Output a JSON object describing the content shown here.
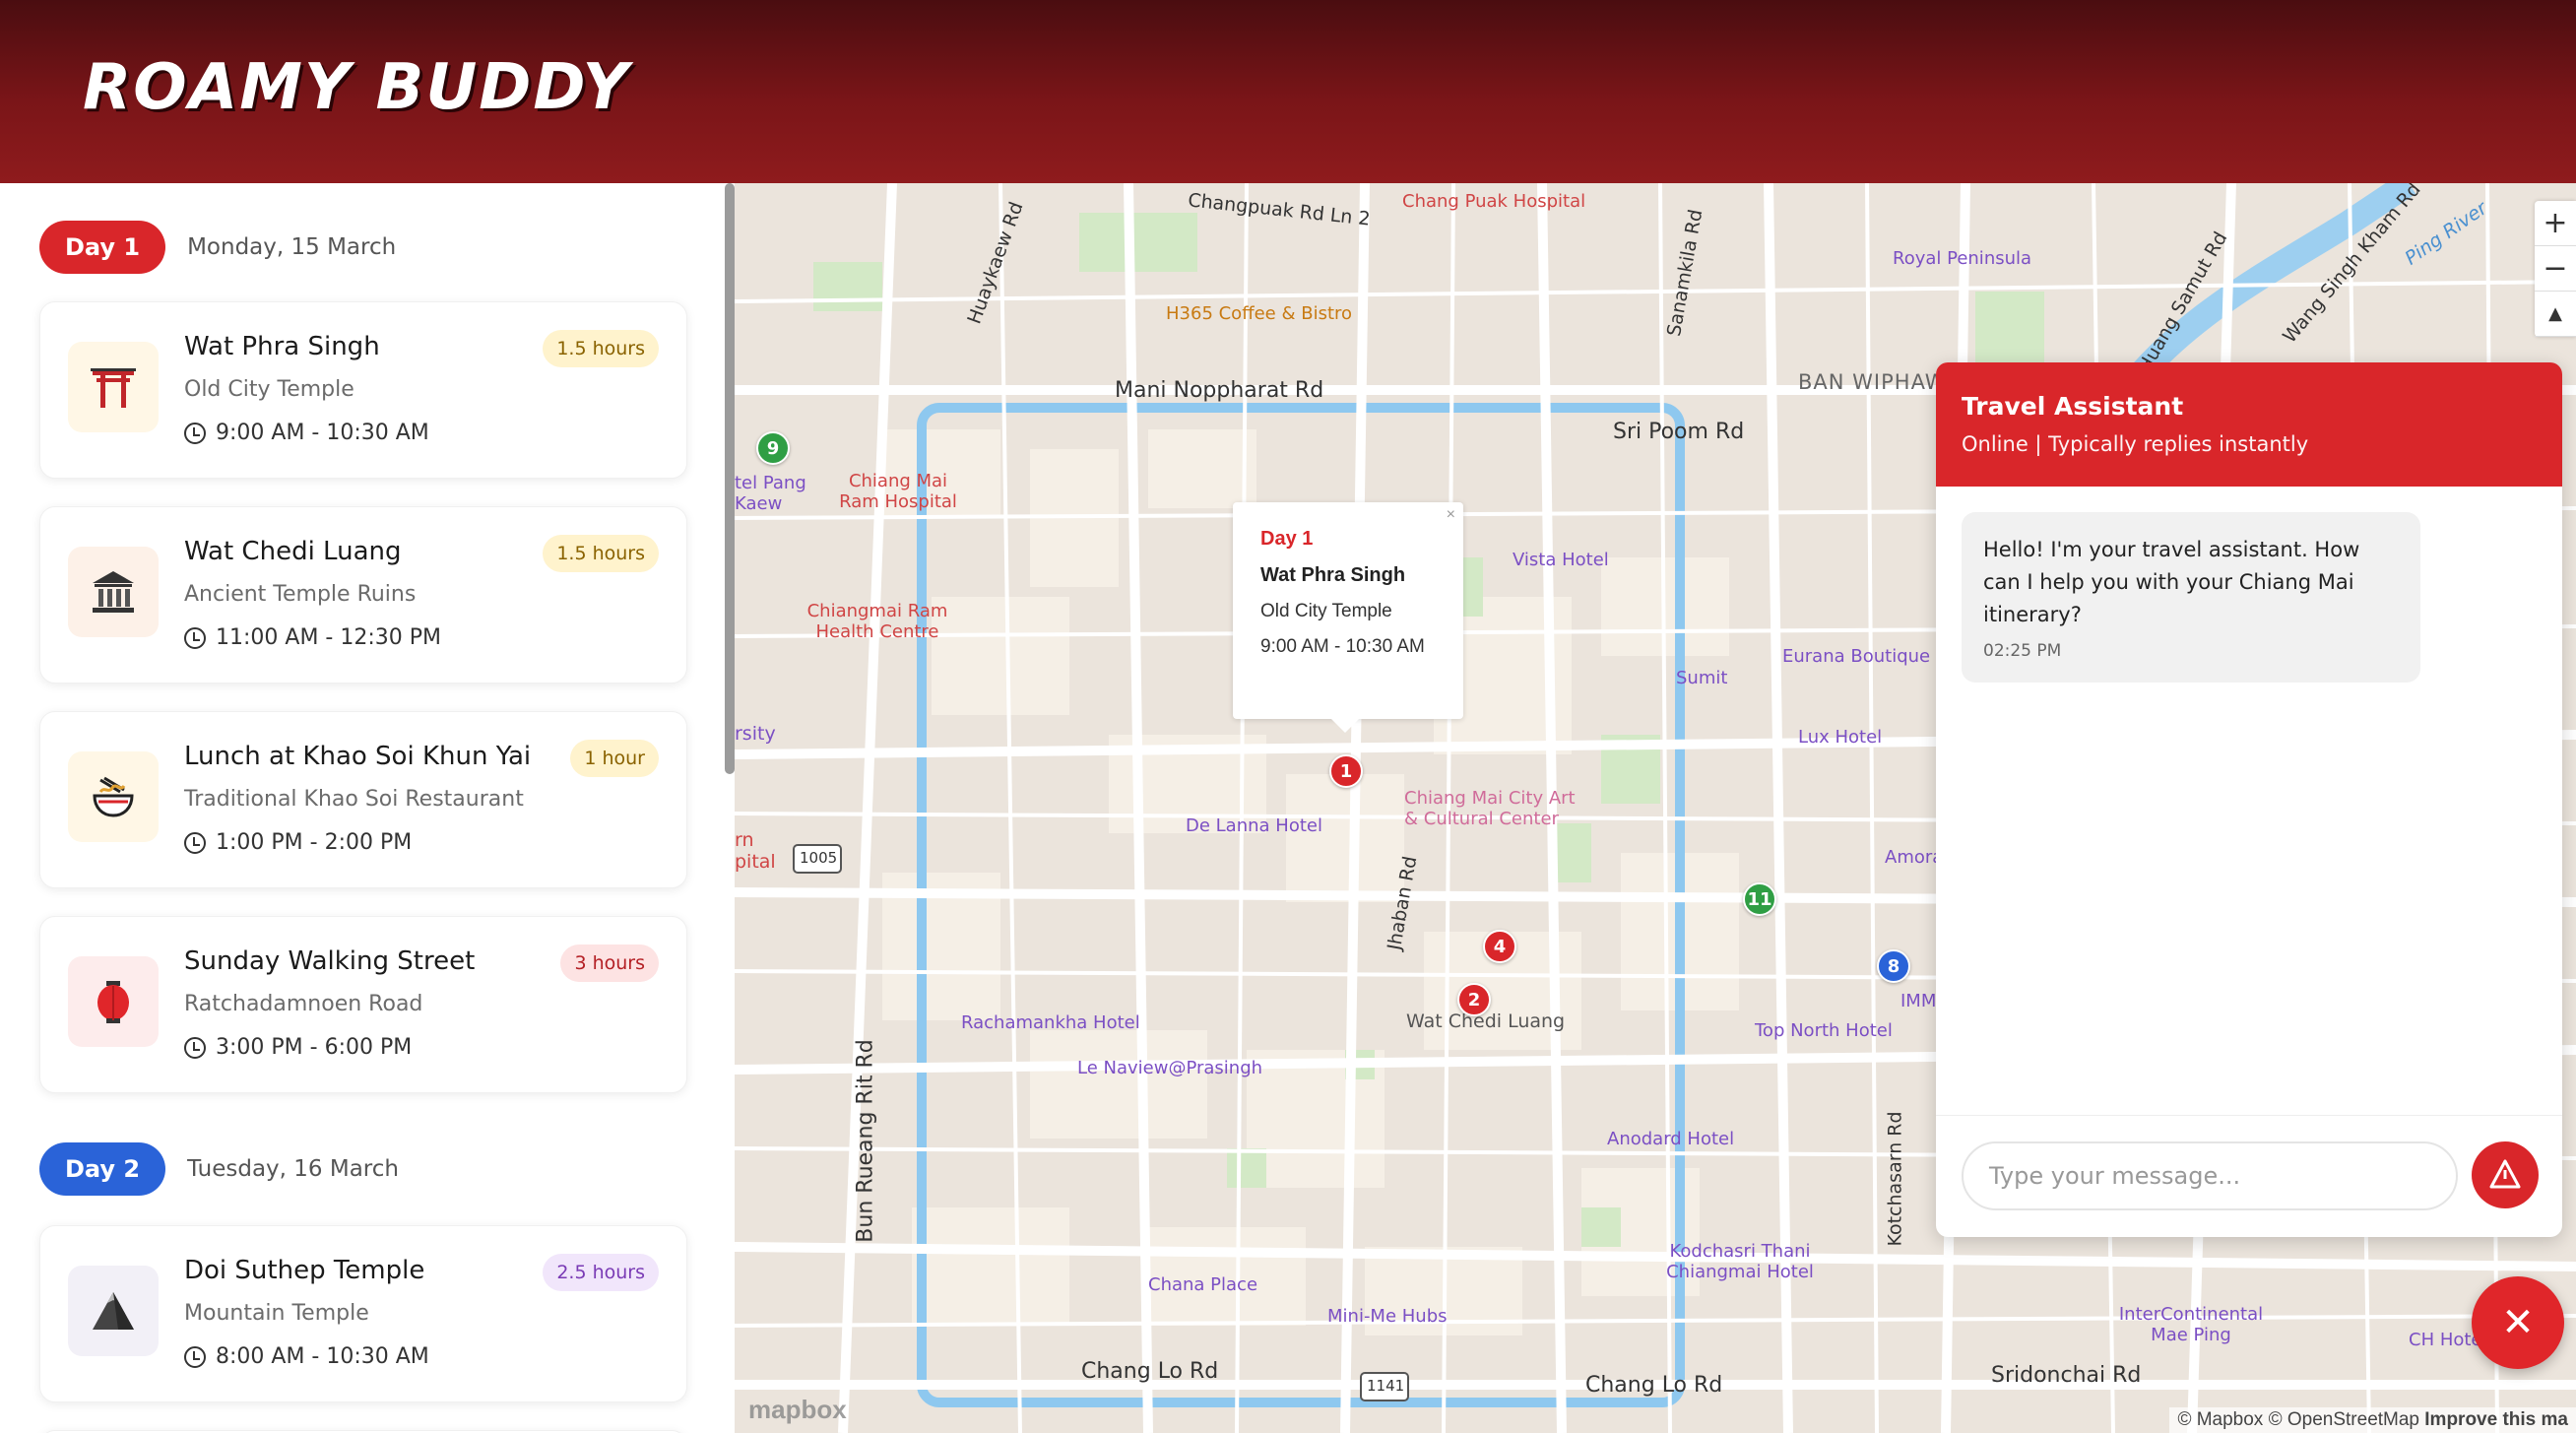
{
  "app": {
    "logo": "ROAMY BUDDY"
  },
  "colors": {
    "header": "#7a1518",
    "accent_red": "#d9262a",
    "day2_blue": "#2a63d8"
  },
  "days": [
    {
      "label": "Day 1",
      "date": "Monday, 15 March"
    },
    {
      "label": "Day 2",
      "date": "Tuesday, 16 March"
    }
  ],
  "activities": [
    {
      "title": "Wat Phra Singh",
      "subtitle": "Old City Temple",
      "time": "9:00 AM - 10:30 AM",
      "duration": "1.5 hours",
      "icon": "torii-gate-icon"
    },
    {
      "title": "Wat Chedi Luang",
      "subtitle": "Ancient Temple Ruins",
      "time": "11:00 AM - 12:30 PM",
      "duration": "1.5 hours",
      "icon": "classical-building-icon"
    },
    {
      "title": "Lunch at Khao Soi Khun Yai",
      "subtitle": "Traditional Khao Soi Restaurant",
      "time": "1:00 PM - 2:00 PM",
      "duration": "1 hour",
      "icon": "noodle-bowl-icon"
    },
    {
      "title": "Sunday Walking Street",
      "subtitle": "Ratchadamnoen Road",
      "time": "3:00 PM - 6:00 PM",
      "duration": "3 hours",
      "icon": "lantern-icon"
    },
    {
      "title": "Doi Suthep Temple",
      "subtitle": "Mountain Temple",
      "time": "8:00 AM - 10:30 AM",
      "duration": "2.5 hours",
      "icon": "mountain-icon"
    }
  ],
  "map": {
    "popup": {
      "day": "Day 1",
      "title": "Wat Phra Singh",
      "subtitle": "Old City Temple",
      "time": "9:00 AM - 10:30 AM"
    },
    "markers": [
      "1",
      "2",
      "4",
      "8",
      "9",
      "11"
    ],
    "roads": [
      "Changpuak Rd Ln 2",
      "Mani Noppharat Rd",
      "Sri Poom Rd",
      "Chang Lo Rd",
      "Chang Lo Rd",
      "Sridonchai Rd",
      "Bun Rueang Rit Rd",
      "Jhaban Rd",
      "Kotchasarn Rd",
      "Sanamkila Rd",
      "Huaykaew Rd",
      "Huang Samut Rd",
      "Wang Singh Kham Rd",
      "Ping River"
    ],
    "places": [
      "Chang Puak Hospital",
      "H365 Coffee & Bistro",
      "Royal Peninsula",
      "BAN WIPHAWADI",
      "Vista Hotel",
      "Eurana Boutique",
      "Sumit",
      "Lux Hotel",
      "Chiang Mai City Art & Cultural Center",
      "De Lanna Hotel",
      "Wat Chedi Luang",
      "Rachamankha Hotel",
      "Le Naview@Prasingh",
      "Anodard Hotel",
      "Top North Hotel",
      "Kodchasri Thani Chiangmai Hotel",
      "Chana Place",
      "Mini-Me Hubs",
      "InterContinental Mae Ping",
      "Chiang Mai Ram Hospital",
      "Chiangmai Ram Health Centre",
      "tel Pang Kaew",
      "rsity",
      "rn pital",
      "Amora C",
      "IMM",
      "CH Hote",
      "1005",
      "1141"
    ],
    "zoom_in": "+",
    "zoom_out": "−",
    "compass": "▲",
    "mapbox": "mapbox",
    "attribution": "© Mapbox © OpenStreetMap",
    "improve": "Improve this ma"
  },
  "chat": {
    "title": "Travel Assistant",
    "status": "Online | Typically replies instantly",
    "message": "Hello! I'm your travel assistant. How can I help you with your Chiang Mai itinerary?",
    "timestamp": "02:25 PM",
    "placeholder": "Type your message...",
    "close": "✕"
  }
}
